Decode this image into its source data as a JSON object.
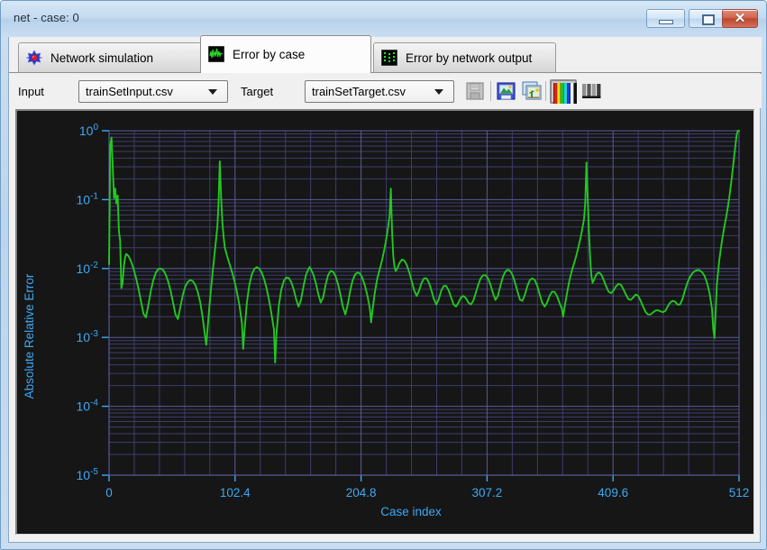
{
  "window": {
    "title": "net - case: 0",
    "controls": {
      "minimize": "minimize-button",
      "maximize": "maximize-button",
      "close": "✕"
    }
  },
  "tabs": [
    {
      "id": "network-simulation",
      "label": "Network simulation",
      "icon": "network-node-icon",
      "active": false
    },
    {
      "id": "error-by-case",
      "label": "Error by case",
      "icon": "waveform-icon",
      "active": true
    },
    {
      "id": "error-by-network-output",
      "label": "Error by network output",
      "icon": "scatter-grid-icon",
      "active": false
    }
  ],
  "toolbar": {
    "input_label": "Input",
    "input_value": "trainSetInput.csv",
    "target_label": "Target",
    "target_value": "trainSetTarget.csv",
    "buttons": [
      {
        "id": "save",
        "icon": "floppy-disk-icon",
        "enabled": false
      },
      {
        "id": "save-image",
        "icon": "save-image-icon",
        "enabled": true
      },
      {
        "id": "copy-image",
        "icon": "copy-image-icon",
        "enabled": true
      },
      {
        "id": "color-mode",
        "icon": "color-bars-icon",
        "enabled": true,
        "selected": true
      },
      {
        "id": "grayscale-mode",
        "icon": "grayscale-bars-icon",
        "enabled": true,
        "selected": false
      }
    ]
  },
  "colors": {
    "plot_background": "#161616",
    "grid_major": "#5a5a9a",
    "grid_minor": "#3d3d6e",
    "axis_text": "#3da9f5",
    "series": "#22c81e",
    "title_bar": "#c5dbf0"
  },
  "chart_data": {
    "type": "line",
    "title": "",
    "xlabel": "Case index",
    "ylabel": "Absolute Relative Error",
    "yscale": "log",
    "xlim": [
      0,
      512
    ],
    "ylim": [
      1e-05,
      1
    ],
    "xticks": [
      0,
      102.4,
      204.8,
      307.2,
      409.6,
      512
    ],
    "xticklabels": [
      "0",
      "102.4",
      "204.8",
      "307.2",
      "409.6",
      "512"
    ],
    "yticks": [
      1,
      0.1,
      0.01,
      0.001,
      0.0001,
      1e-05
    ],
    "yticklabels": [
      "10⁰",
      "10⁻¹",
      "10⁻²",
      "10⁻³",
      "10⁻⁴",
      "10⁻⁵"
    ],
    "grid": true,
    "legend": "none",
    "series_name": "Absolute Relative Error",
    "points": [
      [
        0,
        0.0115
      ],
      [
        1,
        0.62
      ],
      [
        2,
        0.8
      ],
      [
        3,
        0.3
      ],
      [
        4,
        0.105
      ],
      [
        5,
        0.145
      ],
      [
        6,
        0.088
      ],
      [
        7,
        0.115
      ],
      [
        8,
        0.035
      ],
      [
        9,
        0.0255
      ],
      [
        10,
        0.0052
      ],
      [
        11,
        0.0062
      ],
      [
        12,
        0.0105
      ],
      [
        13,
        0.0145
      ],
      [
        14,
        0.0163
      ],
      [
        16,
        0.015
      ],
      [
        18,
        0.0125
      ],
      [
        20,
        0.0098
      ],
      [
        22,
        0.0072
      ],
      [
        24,
        0.005
      ],
      [
        26,
        0.0033
      ],
      [
        28,
        0.0022
      ],
      [
        30,
        0.00195
      ],
      [
        32,
        0.003
      ],
      [
        34,
        0.0048
      ],
      [
        36,
        0.0068
      ],
      [
        38,
        0.0087
      ],
      [
        40,
        0.0098
      ],
      [
        42,
        0.01
      ],
      [
        44,
        0.0095
      ],
      [
        46,
        0.0082
      ],
      [
        48,
        0.0065
      ],
      [
        50,
        0.0048
      ],
      [
        52,
        0.0032
      ],
      [
        54,
        0.00215
      ],
      [
        56,
        0.00185
      ],
      [
        58,
        0.0028
      ],
      [
        60,
        0.0042
      ],
      [
        62,
        0.0055
      ],
      [
        64,
        0.0064
      ],
      [
        66,
        0.0068
      ],
      [
        68,
        0.0066
      ],
      [
        70,
        0.0058
      ],
      [
        72,
        0.0046
      ],
      [
        74,
        0.0033
      ],
      [
        76,
        0.002
      ],
      [
        78,
        0.00105
      ],
      [
        79,
        0.00078
      ],
      [
        80,
        0.0013
      ],
      [
        82,
        0.0035
      ],
      [
        84,
        0.0082
      ],
      [
        86,
        0.018
      ],
      [
        88,
        0.04
      ],
      [
        89,
        0.09
      ],
      [
        90,
        0.36
      ],
      [
        91,
        0.115
      ],
      [
        92,
        0.05
      ],
      [
        93,
        0.03
      ],
      [
        94,
        0.0205
      ],
      [
        96,
        0.015
      ],
      [
        98,
        0.0115
      ],
      [
        100,
        0.0088
      ],
      [
        102,
        0.0065
      ],
      [
        104,
        0.0045
      ],
      [
        106,
        0.0029
      ],
      [
        108,
        0.0016
      ],
      [
        109,
        0.00068
      ],
      [
        110,
        0.0012
      ],
      [
        112,
        0.0032
      ],
      [
        114,
        0.0058
      ],
      [
        116,
        0.0082
      ],
      [
        118,
        0.0098
      ],
      [
        120,
        0.0105
      ],
      [
        122,
        0.01
      ],
      [
        124,
        0.0088
      ],
      [
        126,
        0.007
      ],
      [
        128,
        0.0052
      ],
      [
        130,
        0.0035
      ],
      [
        132,
        0.0022
      ],
      [
        134,
        0.0013
      ],
      [
        135,
        0.00043
      ],
      [
        136,
        0.0011
      ],
      [
        138,
        0.0029
      ],
      [
        140,
        0.005
      ],
      [
        142,
        0.0066
      ],
      [
        144,
        0.0074
      ],
      [
        146,
        0.0073
      ],
      [
        148,
        0.0064
      ],
      [
        150,
        0.005
      ],
      [
        152,
        0.0036
      ],
      [
        154,
        0.0028
      ],
      [
        156,
        0.0035
      ],
      [
        158,
        0.0055
      ],
      [
        160,
        0.008
      ],
      [
        162,
        0.0098
      ],
      [
        163,
        0.0105
      ],
      [
        164,
        0.0098
      ],
      [
        166,
        0.0082
      ],
      [
        168,
        0.0062
      ],
      [
        170,
        0.0043
      ],
      [
        172,
        0.0032
      ],
      [
        174,
        0.0038
      ],
      [
        176,
        0.0058
      ],
      [
        178,
        0.008
      ],
      [
        180,
        0.0092
      ],
      [
        182,
        0.009
      ],
      [
        184,
        0.0078
      ],
      [
        186,
        0.006
      ],
      [
        188,
        0.0042
      ],
      [
        190,
        0.0028
      ],
      [
        192,
        0.00215
      ],
      [
        194,
        0.003
      ],
      [
        196,
        0.0048
      ],
      [
        198,
        0.0068
      ],
      [
        200,
        0.0082
      ],
      [
        202,
        0.0088
      ],
      [
        204,
        0.0084
      ],
      [
        206,
        0.0072
      ],
      [
        208,
        0.0056
      ],
      [
        210,
        0.004
      ],
      [
        212,
        0.0026
      ],
      [
        213,
        0.00165
      ],
      [
        214,
        0.0024
      ],
      [
        216,
        0.0045
      ],
      [
        218,
        0.0072
      ],
      [
        220,
        0.0098
      ],
      [
        222,
        0.0135
      ],
      [
        224,
        0.02
      ],
      [
        226,
        0.032
      ],
      [
        228,
        0.058
      ],
      [
        229,
        0.145
      ],
      [
        230,
        0.035
      ],
      [
        231,
        0.015
      ],
      [
        232,
        0.0105
      ],
      [
        233,
        0.0092
      ],
      [
        234,
        0.0098
      ],
      [
        236,
        0.012
      ],
      [
        238,
        0.0135
      ],
      [
        240,
        0.013
      ],
      [
        242,
        0.0112
      ],
      [
        244,
        0.0088
      ],
      [
        246,
        0.0065
      ],
      [
        248,
        0.0048
      ],
      [
        250,
        0.004
      ],
      [
        252,
        0.0048
      ],
      [
        254,
        0.0062
      ],
      [
        256,
        0.0072
      ],
      [
        258,
        0.0072
      ],
      [
        260,
        0.0062
      ],
      [
        262,
        0.0048
      ],
      [
        264,
        0.0036
      ],
      [
        266,
        0.003
      ],
      [
        268,
        0.0036
      ],
      [
        270,
        0.0048
      ],
      [
        272,
        0.0056
      ],
      [
        274,
        0.0056
      ],
      [
        276,
        0.0048
      ],
      [
        278,
        0.0038
      ],
      [
        280,
        0.003
      ],
      [
        282,
        0.0028
      ],
      [
        284,
        0.0032
      ],
      [
        286,
        0.0038
      ],
      [
        288,
        0.004
      ],
      [
        290,
        0.0037
      ],
      [
        292,
        0.0032
      ],
      [
        294,
        0.003
      ],
      [
        296,
        0.0034
      ],
      [
        298,
        0.0044
      ],
      [
        300,
        0.0058
      ],
      [
        302,
        0.0072
      ],
      [
        304,
        0.008
      ],
      [
        306,
        0.008
      ],
      [
        308,
        0.0072
      ],
      [
        310,
        0.0058
      ],
      [
        312,
        0.0044
      ],
      [
        314,
        0.0035
      ],
      [
        316,
        0.004
      ],
      [
        318,
        0.0056
      ],
      [
        320,
        0.0075
      ],
      [
        322,
        0.009
      ],
      [
        324,
        0.0096
      ],
      [
        326,
        0.0092
      ],
      [
        328,
        0.008
      ],
      [
        330,
        0.0062
      ],
      [
        332,
        0.0046
      ],
      [
        334,
        0.0035
      ],
      [
        336,
        0.0034
      ],
      [
        338,
        0.0042
      ],
      [
        340,
        0.0056
      ],
      [
        342,
        0.0068
      ],
      [
        344,
        0.0072
      ],
      [
        346,
        0.0068
      ],
      [
        348,
        0.0056
      ],
      [
        350,
        0.0042
      ],
      [
        352,
        0.0032
      ],
      [
        354,
        0.0028
      ],
      [
        356,
        0.0032
      ],
      [
        358,
        0.004
      ],
      [
        360,
        0.0046
      ],
      [
        362,
        0.0046
      ],
      [
        364,
        0.004
      ],
      [
        366,
        0.0032
      ],
      [
        368,
        0.0026
      ],
      [
        369,
        0.002
      ],
      [
        370,
        0.0026
      ],
      [
        372,
        0.0042
      ],
      [
        374,
        0.0065
      ],
      [
        376,
        0.0092
      ],
      [
        378,
        0.012
      ],
      [
        380,
        0.016
      ],
      [
        382,
        0.0225
      ],
      [
        384,
        0.033
      ],
      [
        386,
        0.052
      ],
      [
        387,
        0.09
      ],
      [
        388,
        0.345
      ],
      [
        389,
        0.105
      ],
      [
        390,
        0.0345
      ],
      [
        391,
        0.014
      ],
      [
        392,
        0.0078
      ],
      [
        393,
        0.0062
      ],
      [
        394,
        0.0068
      ],
      [
        396,
        0.0082
      ],
      [
        398,
        0.0088
      ],
      [
        400,
        0.0082
      ],
      [
        402,
        0.0068
      ],
      [
        404,
        0.0055
      ],
      [
        406,
        0.0046
      ],
      [
        408,
        0.0044
      ],
      [
        410,
        0.0048
      ],
      [
        412,
        0.0055
      ],
      [
        414,
        0.006
      ],
      [
        416,
        0.0058
      ],
      [
        418,
        0.005
      ],
      [
        420,
        0.0042
      ],
      [
        422,
        0.0036
      ],
      [
        424,
        0.0035
      ],
      [
        426,
        0.0038
      ],
      [
        428,
        0.0042
      ],
      [
        430,
        0.004
      ],
      [
        432,
        0.0034
      ],
      [
        434,
        0.0028
      ],
      [
        436,
        0.00235
      ],
      [
        438,
        0.00215
      ],
      [
        440,
        0.00215
      ],
      [
        442,
        0.0023
      ],
      [
        444,
        0.00245
      ],
      [
        446,
        0.00248
      ],
      [
        448,
        0.0024
      ],
      [
        450,
        0.00232
      ],
      [
        452,
        0.00242
      ],
      [
        454,
        0.0028
      ],
      [
        456,
        0.0032
      ],
      [
        458,
        0.0034
      ],
      [
        460,
        0.0033
      ],
      [
        462,
        0.003
      ],
      [
        464,
        0.003
      ],
      [
        466,
        0.0036
      ],
      [
        468,
        0.0048
      ],
      [
        470,
        0.0062
      ],
      [
        472,
        0.0075
      ],
      [
        474,
        0.0085
      ],
      [
        476,
        0.0092
      ],
      [
        478,
        0.0095
      ],
      [
        480,
        0.0094
      ],
      [
        482,
        0.0088
      ],
      [
        484,
        0.0078
      ],
      [
        486,
        0.0062
      ],
      [
        488,
        0.0044
      ],
      [
        490,
        0.0026
      ],
      [
        491,
        0.00135
      ],
      [
        492,
        0.00098
      ],
      [
        493,
        0.0024
      ],
      [
        494,
        0.006
      ],
      [
        496,
        0.0135
      ],
      [
        498,
        0.0245
      ],
      [
        500,
        0.04
      ],
      [
        502,
        0.062
      ],
      [
        504,
        0.105
      ],
      [
        506,
        0.2
      ],
      [
        508,
        0.42
      ],
      [
        510,
        0.86
      ],
      [
        511,
        1.0
      ],
      [
        512,
        1.0
      ]
    ]
  }
}
